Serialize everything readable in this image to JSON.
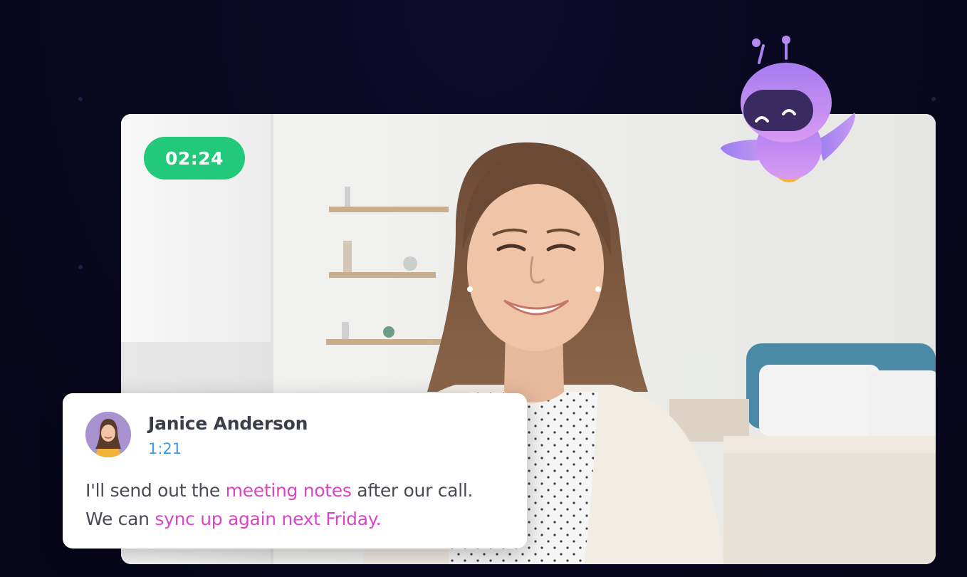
{
  "call": {
    "timer": "02:24"
  },
  "caption": {
    "speaker_name": "Janice Anderson",
    "timestamp": "1:21",
    "line1": {
      "before": "I'll send out the ",
      "highlight": "meeting notes",
      "after": " after our call."
    },
    "line2": {
      "before": "We can ",
      "highlight": "sync up again next Friday."
    }
  },
  "colors": {
    "timer_bg": "#22c97a",
    "highlight": "#d946c4",
    "timestamp": "#3d9bea",
    "background": "#090820",
    "robot": "#b487f2"
  },
  "icons": {
    "assistant": "robot-assistant-icon",
    "avatar": "speaker-avatar"
  }
}
